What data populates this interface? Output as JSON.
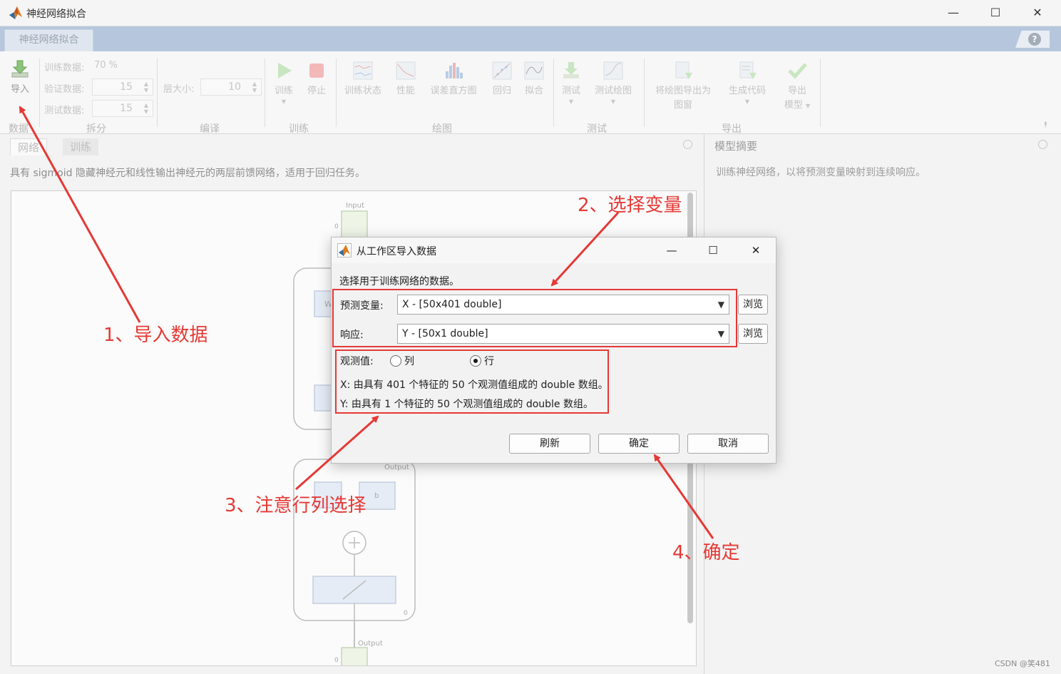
{
  "window": {
    "title": "神经网络拟合",
    "minimize": "—",
    "maximize": "☐",
    "close": "✕"
  },
  "tabs": {
    "main": "神经网络拟合",
    "help": "?"
  },
  "toolstrip": {
    "import": {
      "label": "导入",
      "icon": "import-icon"
    },
    "split": {
      "train_label": "训练数据:",
      "train_value": "70 %",
      "val_label": "验证数据:",
      "val_value": "15",
      "test_label": "测试数据:",
      "test_value": "15"
    },
    "compile": {
      "layer_label": "层大小:",
      "layer_value": "10"
    },
    "train": {
      "train": "训练",
      "stop": "停止"
    },
    "plots": {
      "train_state": "训练状态",
      "performance": "性能",
      "error_hist": "误差直方图",
      "regression": "回归",
      "fit": "拟合"
    },
    "test": {
      "test": "测试",
      "test_plot": "测试绘图"
    },
    "export": {
      "export_fig_1": "将绘图导出为",
      "export_fig_2": "图窗",
      "gen_code": "生成代码",
      "export_model_1": "导出",
      "export_model_2": "模型"
    },
    "group_labels": {
      "data": "数据",
      "split": "拆分",
      "compile": "编译",
      "train": "训练",
      "plots": "绘图",
      "test": "测试",
      "export": "导出"
    }
  },
  "left_panel": {
    "tabs": [
      "网络",
      "训练"
    ],
    "description": "具有 sigmoid 隐藏神经元和线性输出神经元的两层前馈网络，适用于回归任务。",
    "diagram": {
      "input": "Input",
      "output_layer": "Output",
      "output": "Output",
      "w1": "W",
      "b": "b",
      "zero": "0"
    }
  },
  "right_panel": {
    "title": "模型摘要",
    "description": "训练神经网络，以将预测变量映射到连续响应。",
    "watermark": "CSDN @笑481"
  },
  "dialog": {
    "title": "从工作区导入数据",
    "instruction": "选择用于训练网络的数据。",
    "predictor_label": "预测变量:",
    "predictor_value": "X - [50x401 double]",
    "response_label": "响应:",
    "response_value": "Y - [50x1 double]",
    "browse": "浏览",
    "observations_label": "观测值:",
    "option_col": "列",
    "option_row": "行",
    "selected": "行",
    "x_info": "X: 由具有 401 个特征的 50 个观测值组成的 double 数组。",
    "y_info": "Y: 由具有 1 个特征的 50 个观测值组成的 double 数组。",
    "refresh": "刷新",
    "ok": "确定",
    "cancel": "取消"
  },
  "annotations": {
    "step1": "1、导入数据",
    "step2": "2、选择变量",
    "step3": "3、注意行列选择",
    "step4": "4、确定",
    "color": "#e53935"
  }
}
